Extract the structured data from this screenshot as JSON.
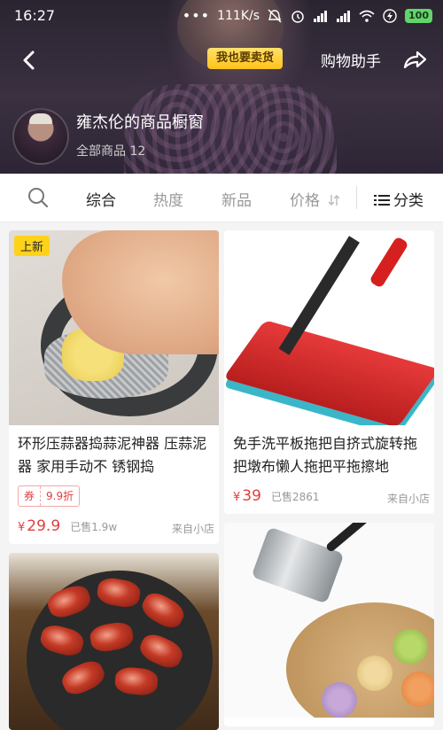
{
  "status_bar": {
    "time": "16:27",
    "network_speed": "111K/s",
    "battery": "100"
  },
  "header": {
    "sell_badge": "我也要卖货",
    "assistant_label": "购物助手",
    "shop_name": "雍杰伦的商品橱窗",
    "product_count_label": "全部商品 12"
  },
  "filter_bar": {
    "tabs": [
      {
        "label": "综合",
        "active": true
      },
      {
        "label": "热度",
        "active": false
      },
      {
        "label": "新品",
        "active": false
      },
      {
        "label": "价格",
        "active": false
      }
    ],
    "category_label": "分类"
  },
  "products": [
    {
      "badge": "上新",
      "title": "环形压蒜器捣蒜泥神器 压蒜泥器 家用手动不 锈钢捣",
      "coupon_tag": "券",
      "coupon_value": "9.9折",
      "price": "29.9",
      "sold": "已售1.9w",
      "source": "来自小店"
    },
    {
      "title": "免手洗平板拖把自挤式旋转拖把墩布懒人拖把平拖擦地",
      "price": "39",
      "sold": "已售2861",
      "source": "来自小店"
    },
    {
      "title": ""
    },
    {
      "title": ""
    }
  ],
  "currency_symbol": "¥",
  "colors": {
    "accent": "#e43d3d",
    "badge_yellow": "#ffd21a",
    "active_tab": "#222222"
  }
}
